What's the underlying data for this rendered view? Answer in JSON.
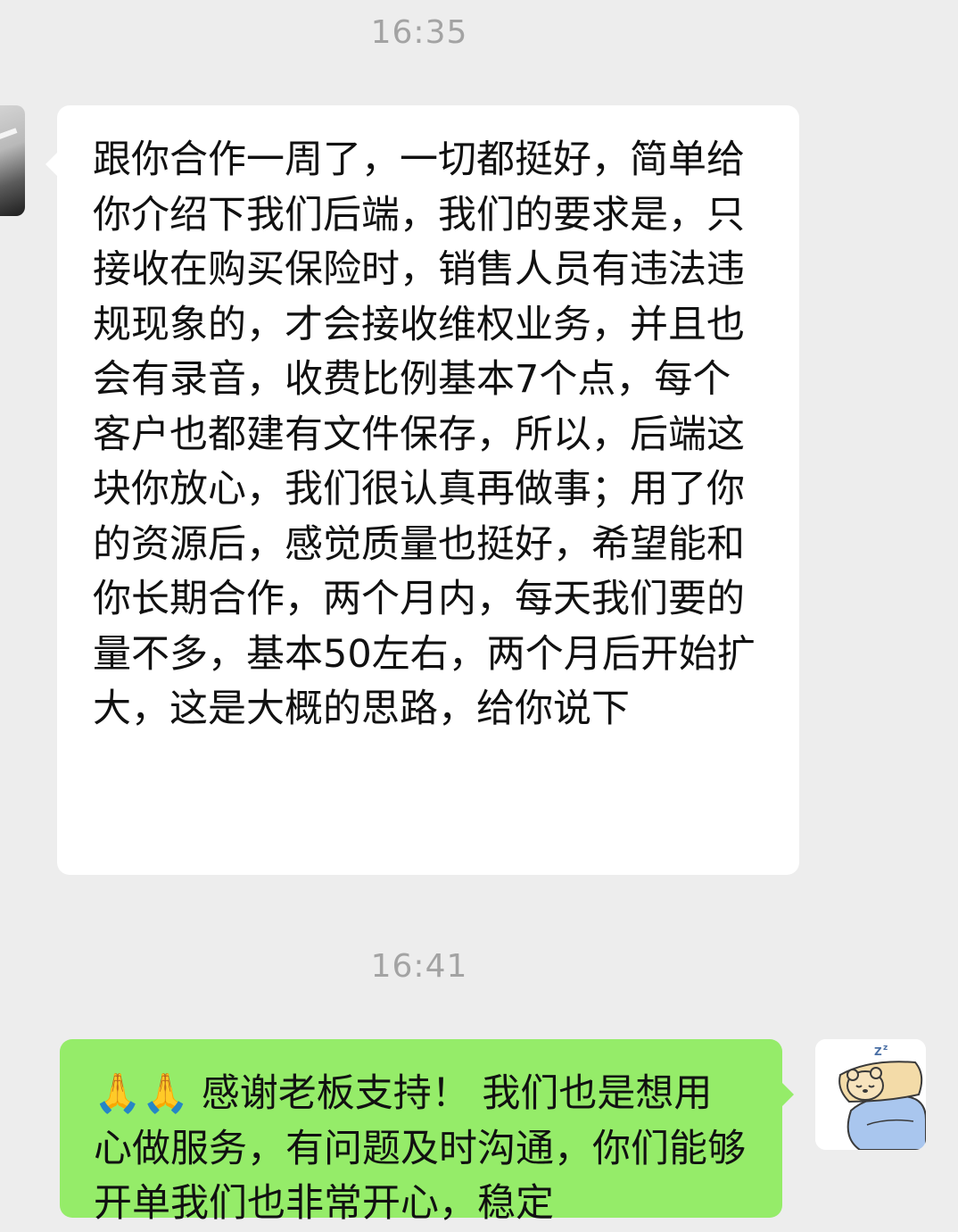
{
  "chat": {
    "messages": [
      {
        "timestamp": "16:35",
        "sender": "other",
        "text": "跟你合作一周了，一切都挺好，简单给你介绍下我们后端，我们的要求是，只接收在购买保险时，销售人员有违法违规现象的，才会接收维权业务，并且也会有录音，收费比例基本7个点，每个客户也都建有文件保存，所以，后端这块你放心，我们很认真再做事；用了你的资源后，感觉质量也挺好，希望能和你长期合作，两个月内，每天我们要的量不多，基本50左右，两个月后开始扩大，这是大概的思路，给你说下"
      },
      {
        "timestamp": "16:41",
        "sender": "self",
        "text": "🙏🙏 感谢老板支持！ 我们也是想用心做服务，有问题及时沟通，你们能够开单我们也非常开心，稳定"
      }
    ]
  },
  "colors": {
    "background": "#ededed",
    "incoming_bubble": "#ffffff",
    "outgoing_bubble": "#95ec69",
    "timestamp": "#a3a3a3"
  },
  "icons": {
    "left_avatar": "contact-avatar-photo",
    "right_avatar": "sleeping-bear-avatar"
  }
}
